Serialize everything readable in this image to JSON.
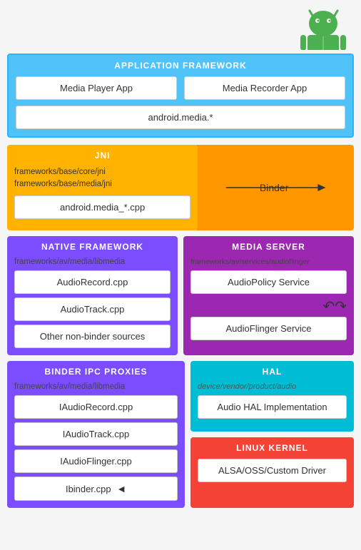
{
  "android": {
    "logo_color": "#4caf50",
    "body_color": "#4caf50"
  },
  "app_framework": {
    "title": "APPLICATION FRAMEWORK",
    "media_player": "Media Player App",
    "media_recorder": "Media Recorder App",
    "android_media": "android.media.*"
  },
  "jni": {
    "title": "JNI",
    "line1": "frameworks/base/core/jni",
    "line2": "frameworks/base/media/jni",
    "cpp": "android.media_*.cpp",
    "binder_label": "Binder"
  },
  "native_framework": {
    "title": "NATIVE FRAMEWORK",
    "path": "frameworks/av/media/libmedia",
    "items": [
      "AudioRecord.cpp",
      "AudioTrack.cpp",
      "Other non-binder sources"
    ]
  },
  "media_server": {
    "title": "MEDIA SERVER",
    "path": "frameworks/av/services/audioflinger",
    "items": [
      "AudioPolicy Service",
      "AudioFlinger Service"
    ]
  },
  "binder_ipc": {
    "title": "BINDER IPC PROXIES",
    "path": "frameworks/av/media/libmedia",
    "items": [
      "IAudioRecord.cpp",
      "IAudioTrack.cpp",
      "IAudioFlinger.cpp",
      "Ibinder.cpp"
    ]
  },
  "hal": {
    "title": "HAL",
    "path": "device/vendor/product/audio",
    "items": [
      "Audio HAL Implementation"
    ]
  },
  "linux_kernel": {
    "title": "LINUX KERNEL",
    "items": [
      "ALSA/OSS/Custom Driver"
    ]
  }
}
